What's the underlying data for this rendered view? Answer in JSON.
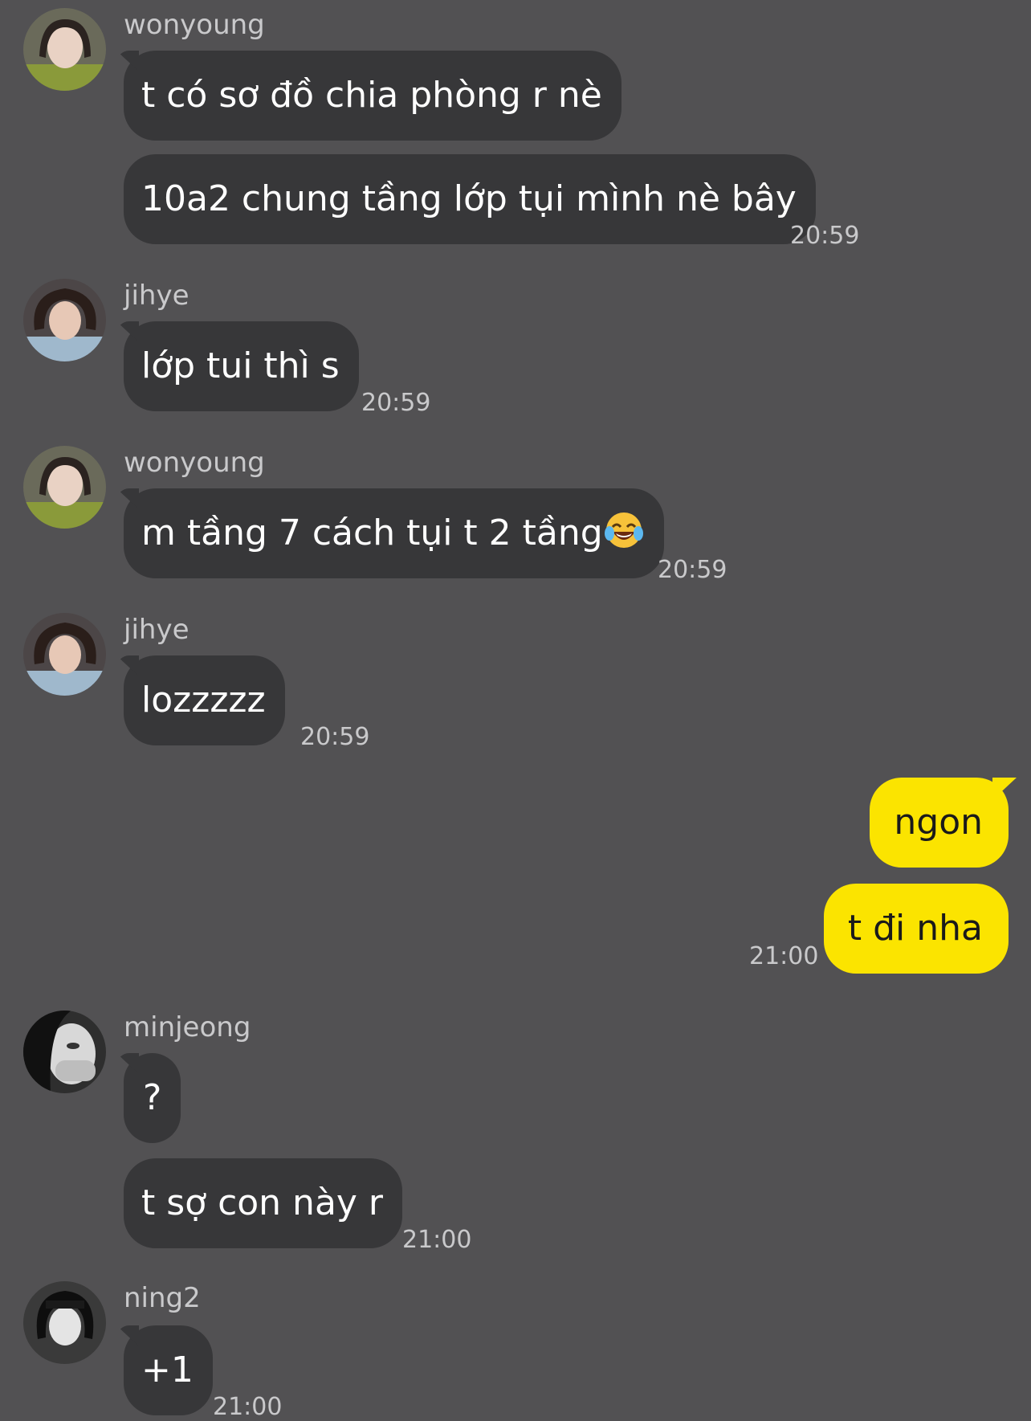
{
  "messages": [
    {
      "sender": "wonyoung",
      "avatar": "wonyoung-avatar",
      "lines": [
        "t có sơ đồ chia phòng r nè",
        "10a2 chung tầng lớp tụi mình nè bây"
      ],
      "time": "20:59"
    },
    {
      "sender": "jihye",
      "avatar": "jihye-avatar",
      "lines": [
        "lớp tui thì s"
      ],
      "time": "20:59"
    },
    {
      "sender": "wonyoung",
      "avatar": "wonyoung-avatar",
      "lines": [
        "m tầng 7 cách tụi t 2 tầng"
      ],
      "emoji": "face-with-tears-of-joy",
      "time": "20:59"
    },
    {
      "sender": "jihye",
      "avatar": "jihye-avatar",
      "lines": [
        "lozzzzz"
      ],
      "time": "20:59"
    },
    {
      "sender": "me",
      "lines": [
        "ngon",
        "t đi nha"
      ],
      "time": "21:00"
    },
    {
      "sender": "minjeong",
      "avatar": "minjeong-avatar",
      "lines": [
        "?",
        "t sợ con này r"
      ],
      "time": "21:00"
    },
    {
      "sender": "ning2",
      "avatar": "ning2-avatar",
      "lines": [
        "+1"
      ],
      "time": "21:00"
    }
  ],
  "colors": {
    "background": "#525153",
    "incoming_bubble": "#373739",
    "outgoing_bubble": "#fbe400",
    "meta_text": "#c9c9cb"
  }
}
